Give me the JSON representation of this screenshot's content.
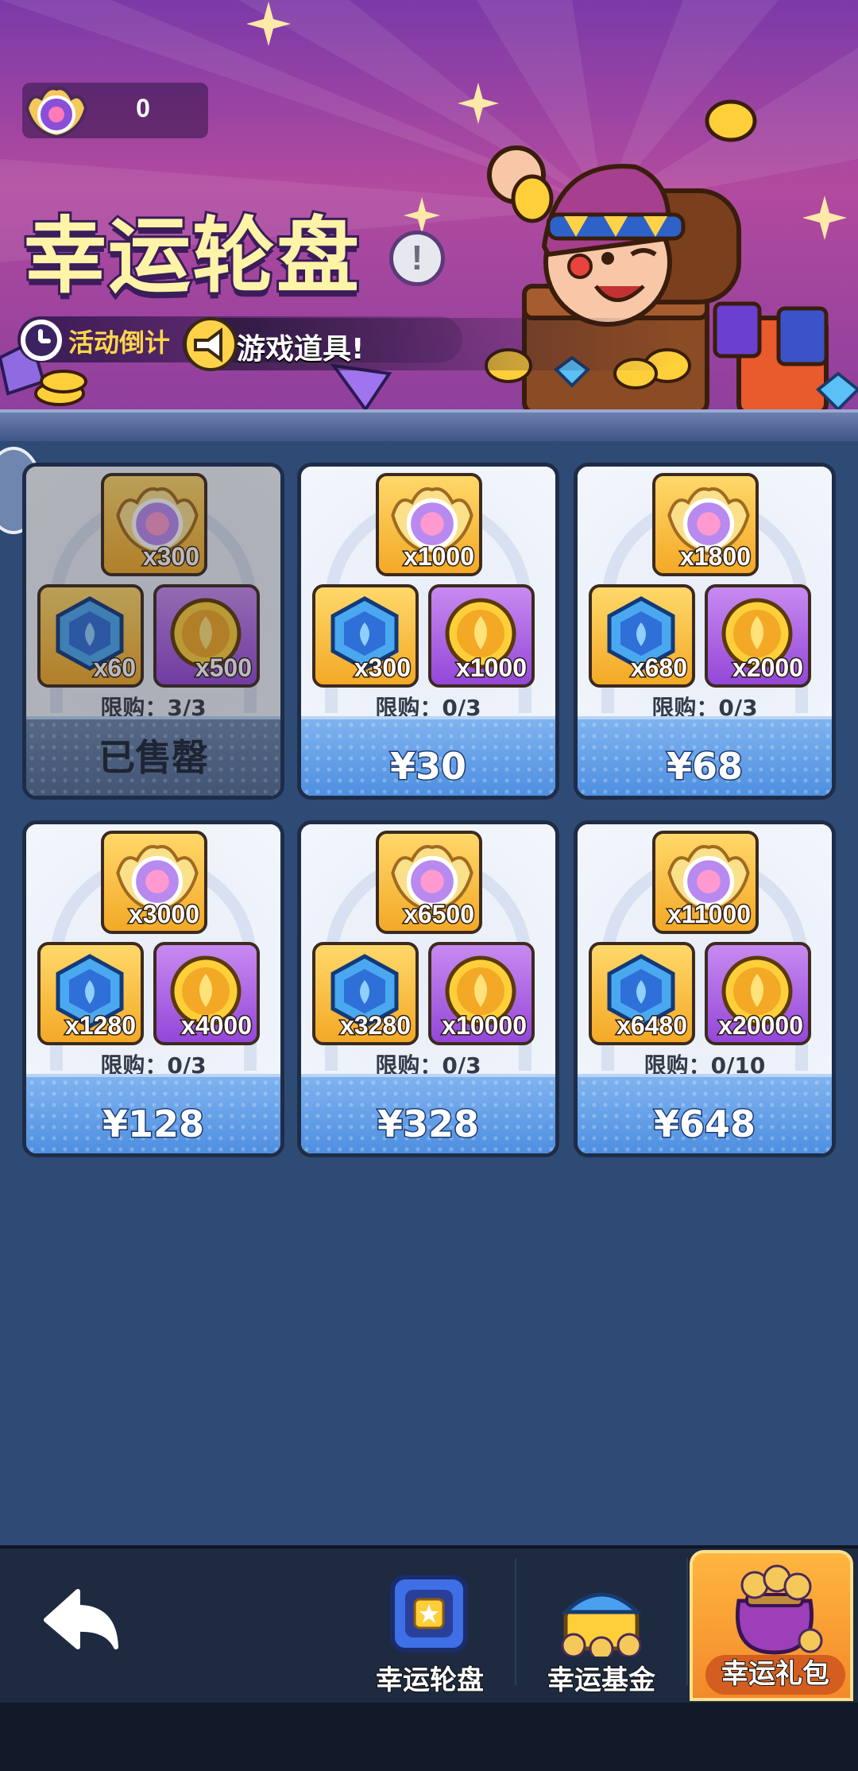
{
  "header": {
    "currency_value": "0",
    "title": "幸运轮盘",
    "countdown_label": "活动倒计",
    "marquee_text": "游戏道具!"
  },
  "packs": [
    {
      "top_qty": "x300",
      "blue_qty": "x60",
      "coin_qty": "x500",
      "limit": "限购：3/3",
      "price": "已售罄",
      "sold_out": true
    },
    {
      "top_qty": "x1000",
      "blue_qty": "x300",
      "coin_qty": "x1000",
      "limit": "限购：0/3",
      "price": "¥30",
      "sold_out": false
    },
    {
      "top_qty": "x1800",
      "blue_qty": "x680",
      "coin_qty": "x2000",
      "limit": "限购：0/3",
      "price": "¥68",
      "sold_out": false
    },
    {
      "top_qty": "x3000",
      "blue_qty": "x1280",
      "coin_qty": "x4000",
      "limit": "限购：0/3",
      "price": "¥128",
      "sold_out": false
    },
    {
      "top_qty": "x6500",
      "blue_qty": "x3280",
      "coin_qty": "x10000",
      "limit": "限购：0/3",
      "price": "¥328",
      "sold_out": false
    },
    {
      "top_qty": "x11000",
      "blue_qty": "x6480",
      "coin_qty": "x20000",
      "limit": "限购：0/10",
      "price": "¥648",
      "sold_out": false
    }
  ],
  "nav": {
    "tab_wheel": "幸运轮盘",
    "tab_fund": "幸运基金",
    "tab_gift": "幸运礼包",
    "active_tab": "幸运礼包"
  },
  "colors": {
    "page_bg": "#2e4b75",
    "price_bar": "#4e8fe0",
    "active_tab": "#f3892a",
    "title_fill": "#fff3a8"
  }
}
